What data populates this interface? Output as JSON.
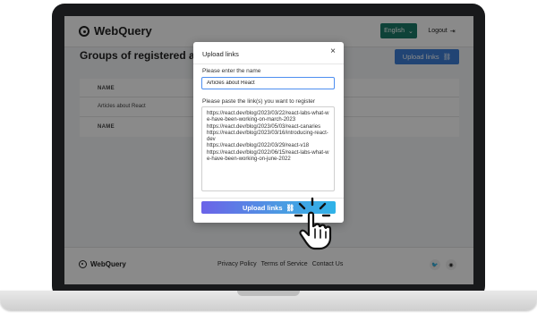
{
  "header": {
    "logo_text": "WebQuery",
    "language_label": "English",
    "logout_label": "Logout"
  },
  "main": {
    "title": "Groups of registered articles",
    "upload_button_label": "Upload links",
    "table": {
      "column_header": "NAME",
      "rows": [
        "Articles about React"
      ],
      "footer_header": "NAME"
    }
  },
  "modal": {
    "title": "Upload links",
    "close_label": "×",
    "name_label": "Please enter the name",
    "name_value": "Articles about React",
    "links_label": "Please paste the link(s) you want to register",
    "links_value": "https://react.dev/blog/2023/03/22/react-labs-what-we-have-been-working-on-march-2023\nhttps://react.dev/blog/2023/05/03/react-canaries\nhttps://react.dev/blog/2023/03/16/introducing-react-dev\nhttps://react.dev/blog/2022/03/29/react-v18\nhttps://react.dev/blog/2022/06/15/react-labs-what-we-have-been-working-on-june-2022",
    "upload_button_label": "Upload links"
  },
  "footer": {
    "logo_text": "WebQuery",
    "links": [
      "Privacy Policy",
      "Terms of Service",
      "Contact Us"
    ],
    "social_icons": [
      "twitter-icon",
      "discord-icon"
    ]
  },
  "colors": {
    "language_button": "#1b7b68",
    "upload_button": "#3d7fd6",
    "modal_gradient_start": "#6b63e8",
    "modal_gradient_end": "#2fb3e8"
  }
}
